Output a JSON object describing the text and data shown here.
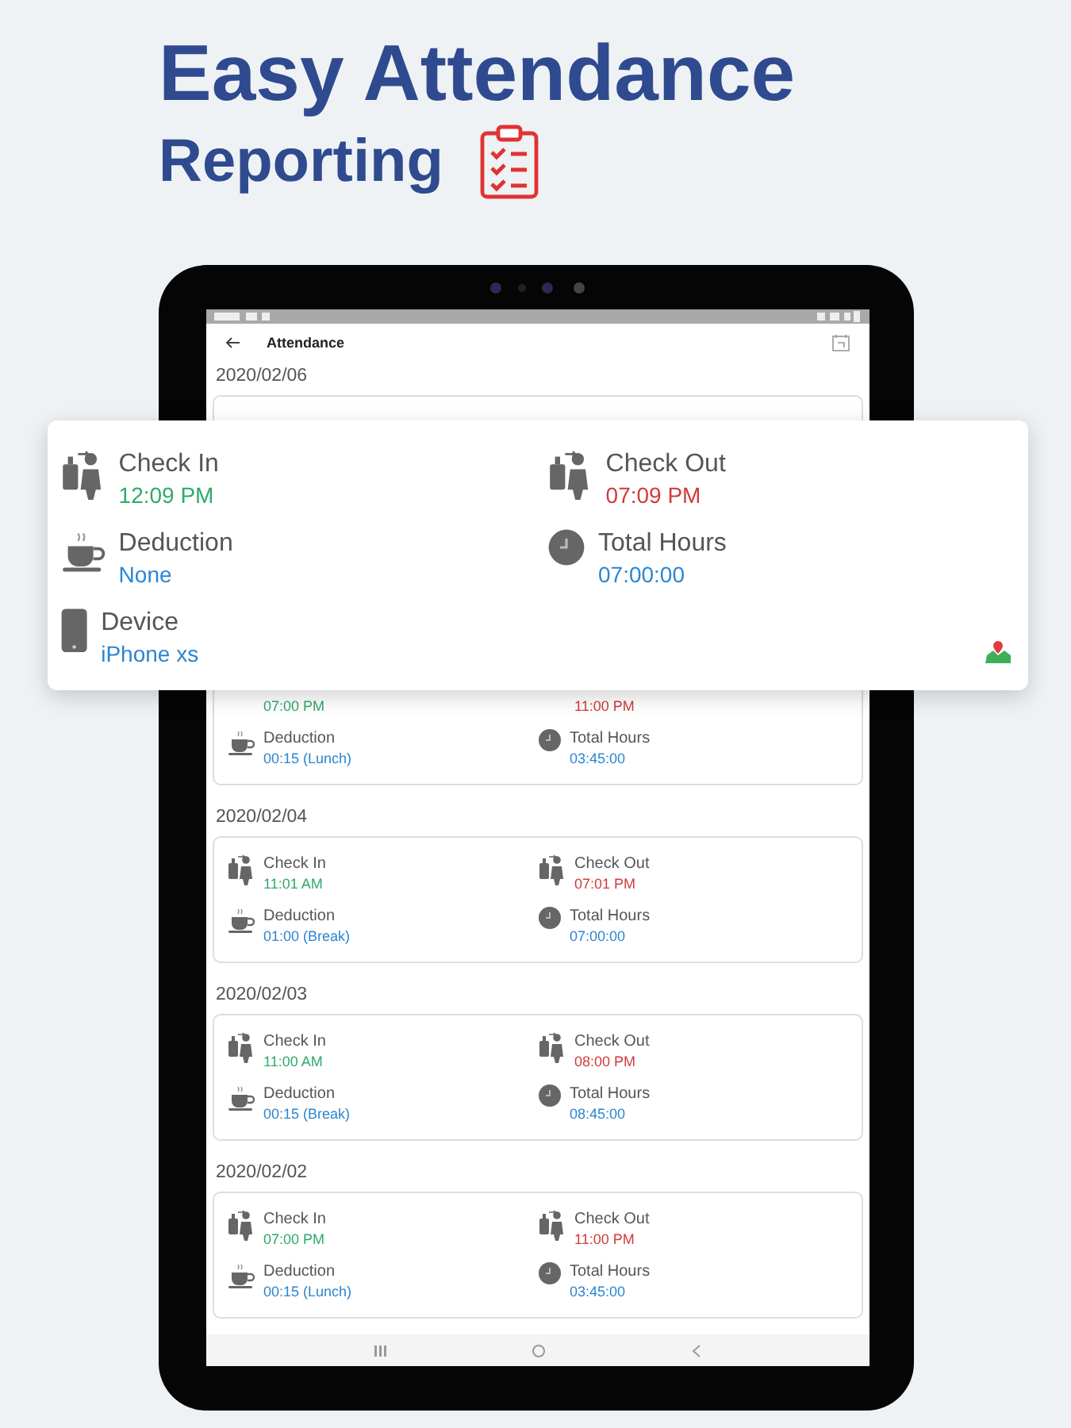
{
  "headline": {
    "line1": "Easy Attendance",
    "line2": "Reporting"
  },
  "app_bar": {
    "title": "Attendance"
  },
  "first_date": "2020/02/06",
  "detail": {
    "check_in": {
      "label": "Check In",
      "value": "12:09 PM"
    },
    "check_out": {
      "label": "Check Out",
      "value": "07:09 PM"
    },
    "deduction": {
      "label": "Deduction",
      "value": "None"
    },
    "total_hours": {
      "label": "Total Hours",
      "value": "07:00:00"
    },
    "device": {
      "label": "Device",
      "value": "iPhone xs"
    }
  },
  "days": [
    {
      "kind": "partial",
      "check_in": {
        "value": "07:00 PM"
      },
      "check_out": {
        "value": "11:00 PM"
      },
      "deduction": {
        "label": "Deduction",
        "value": "00:15 (Lunch)"
      },
      "total_hours": {
        "label": "Total Hours",
        "value": "03:45:00"
      }
    },
    {
      "kind": "full",
      "date": "2020/02/04",
      "check_in": {
        "label": "Check In",
        "value": "11:01 AM"
      },
      "check_out": {
        "label": "Check Out",
        "value": "07:01 PM"
      },
      "deduction": {
        "label": "Deduction",
        "value": "01:00 (Break)"
      },
      "total_hours": {
        "label": "Total Hours",
        "value": "07:00:00"
      }
    },
    {
      "kind": "full",
      "date": "2020/02/03",
      "check_in": {
        "label": "Check In",
        "value": "11:00 AM"
      },
      "check_out": {
        "label": "Check Out",
        "value": "08:00 PM"
      },
      "deduction": {
        "label": "Deduction",
        "value": "00:15 (Break)"
      },
      "total_hours": {
        "label": "Total Hours",
        "value": "08:45:00"
      }
    },
    {
      "kind": "full",
      "date": "2020/02/02",
      "check_in": {
        "label": "Check In",
        "value": "07:00 PM"
      },
      "check_out": {
        "label": "Check Out",
        "value": "11:00 PM"
      },
      "deduction": {
        "label": "Deduction",
        "value": "00:15 (Lunch)"
      },
      "total_hours": {
        "label": "Total Hours",
        "value": "03:45:00"
      }
    }
  ]
}
